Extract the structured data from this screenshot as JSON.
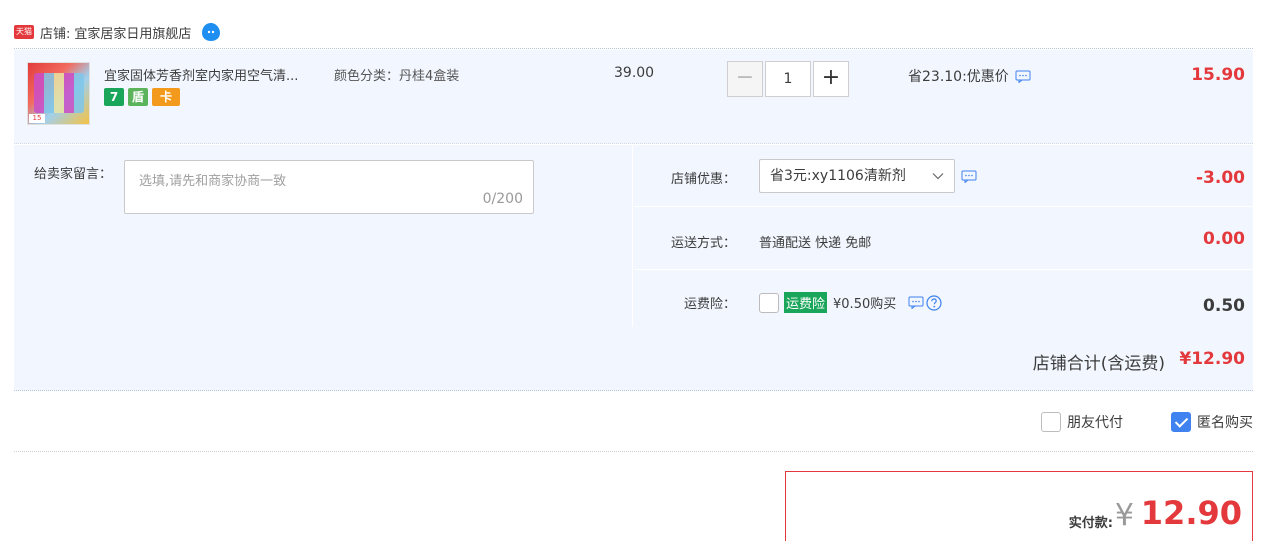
{
  "shop": {
    "badge": "天猫",
    "prefix": "店铺:",
    "name": "宜家居家日用旗舰店"
  },
  "item": {
    "thumb_price": "15",
    "title": "宜家固体芳香剂室内家用空气清...",
    "sku": "颜色分类：丹桂4盒装",
    "badges": [
      "7",
      "盾",
      "卡"
    ],
    "unit_price": "39.00",
    "qty_minus": "−",
    "qty_plus": "+",
    "qty_value": "1",
    "saving": "省23.10:优惠价",
    "subtotal": "15.90"
  },
  "memo": {
    "label": "给卖家留言：",
    "placeholder": "选填,请先和商家协商一致",
    "count": "0/200"
  },
  "options": {
    "coupon": {
      "label": "店铺优惠：",
      "value": "省3元:xy1106清新剂",
      "amount": "-3.00"
    },
    "shipping": {
      "label": "运送方式：",
      "value": "普通配送 快递 免邮",
      "amount": "0.00"
    },
    "insurance": {
      "label": "运费险：",
      "tag": "运费险",
      "value": "¥0.50购买",
      "amount": "0.50"
    }
  },
  "total": {
    "label": "店铺合计(含运费)",
    "amount": "¥12.90"
  },
  "extras": {
    "friend_pay": "朋友代付",
    "anonymous": "匿名购买"
  },
  "payment": {
    "label": "实付款:",
    "yen": "¥",
    "amount": "12.90"
  },
  "colors": {
    "accent": "#e4393c",
    "row_bg": "#f2f7ff",
    "check_blue": "#3f82f0",
    "tag_green": "#19a55a"
  }
}
